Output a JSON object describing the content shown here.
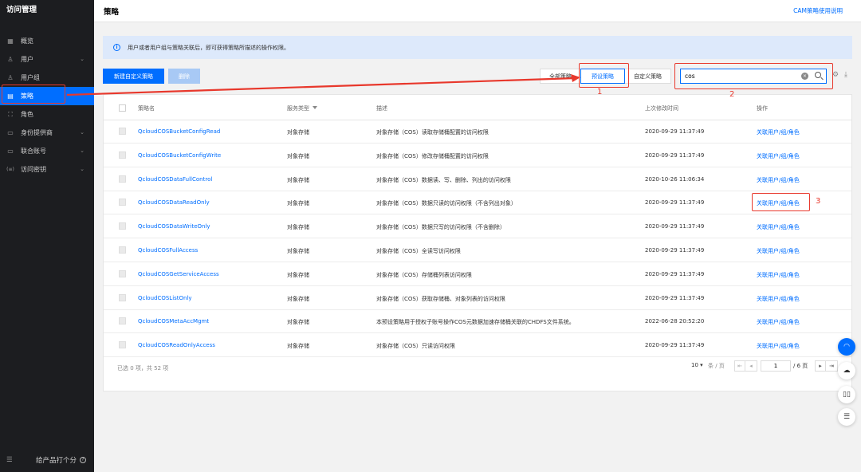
{
  "app": {
    "title": "访问管理"
  },
  "sidebar": {
    "items": [
      {
        "label": "概览",
        "icon": "grid-icon",
        "chevron": false,
        "active": false
      },
      {
        "label": "用户",
        "icon": "user-icon",
        "chevron": true,
        "active": false
      },
      {
        "label": "用户组",
        "icon": "users-icon",
        "chevron": false,
        "active": false
      },
      {
        "label": "策略",
        "icon": "policy-icon",
        "chevron": false,
        "active": true
      },
      {
        "label": "角色",
        "icon": "role-icon",
        "chevron": false,
        "active": false
      },
      {
        "label": "身份提供商",
        "icon": "idp-icon",
        "chevron": true,
        "active": false
      },
      {
        "label": "联合账号",
        "icon": "account-icon",
        "chevron": true,
        "active": false
      },
      {
        "label": "访问密钥",
        "icon": "key-icon",
        "chevron": true,
        "active": false
      }
    ],
    "feedback_label": "给产品打个分"
  },
  "header": {
    "title": "策略",
    "doc_link": "CAM策略使用说明"
  },
  "info": {
    "text": "用户或者用户组与策略关联后，即可获得策略所描述的操作权限。"
  },
  "toolbar": {
    "create_label": "新建自定义策略",
    "delete_label": "删除",
    "tabs": [
      "全部策略",
      "预设策略",
      "自定义策略"
    ],
    "active_tab": 1,
    "search_value": "cos"
  },
  "annotations": {
    "one": "1",
    "two": "2",
    "three": "3"
  },
  "table": {
    "headers": {
      "name": "策略名",
      "service": "服务类型",
      "desc": "描述",
      "time": "上次修改时间",
      "op": "操作"
    },
    "rows": [
      {
        "name": "QcloudCOSBucketConfigRead",
        "service": "对象存储",
        "desc": "对象存储（COS）读取存储桶配置的访问权限",
        "time": "2020-09-29 11:37:49",
        "op": "关联用户/组/角色"
      },
      {
        "name": "QcloudCOSBucketConfigWrite",
        "service": "对象存储",
        "desc": "对象存储（COS）修改存储桶配置的访问权限",
        "time": "2020-09-29 11:37:49",
        "op": "关联用户/组/角色"
      },
      {
        "name": "QcloudCOSDataFullControl",
        "service": "对象存储",
        "desc": "对象存储（COS）数据读、写、删除、列出的访问权限",
        "time": "2020-10-26 11:06:34",
        "op": "关联用户/组/角色"
      },
      {
        "name": "QcloudCOSDataReadOnly",
        "service": "对象存储",
        "desc": "对象存储（COS）数据只读的访问权限（不含列出对象）",
        "time": "2020-09-29 11:37:49",
        "op": "关联用户/组/角色"
      },
      {
        "name": "QcloudCOSDataWriteOnly",
        "service": "对象存储",
        "desc": "对象存储（COS）数据只写的访问权限（不含删除）",
        "time": "2020-09-29 11:37:49",
        "op": "关联用户/组/角色"
      },
      {
        "name": "QcloudCOSFullAccess",
        "service": "对象存储",
        "desc": "对象存储（COS）全读写访问权限",
        "time": "2020-09-29 11:37:49",
        "op": "关联用户/组/角色"
      },
      {
        "name": "QcloudCOSGetServiceAccess",
        "service": "对象存储",
        "desc": "对象存储（COS）存储桶列表访问权限",
        "time": "2020-09-29 11:37:49",
        "op": "关联用户/组/角色"
      },
      {
        "name": "QcloudCOSListOnly",
        "service": "对象存储",
        "desc": "对象存储（COS）获取存储桶、对象列表的访问权限",
        "time": "2020-09-29 11:37:49",
        "op": "关联用户/组/角色"
      },
      {
        "name": "QcloudCOSMetaAccMgmt",
        "service": "对象存储",
        "desc": "本预设策略用于授权子账号操作COS元数据加速存储桶关联的CHDFS文件系统。",
        "time": "2022-06-28 20:52:20",
        "op": "关联用户/组/角色"
      },
      {
        "name": "QcloudCOSReadOnlyAccess",
        "service": "对象存储",
        "desc": "对象存储（COS）只读访问权限",
        "time": "2020-09-29 11:37:49",
        "op": "关联用户/组/角色"
      }
    ],
    "footer": "已选 0 项，共 52 项"
  },
  "pagination": {
    "page_size": "10 ▾",
    "per_page_label": "条 / 页",
    "current_page": "1",
    "total_label": "/ 6 页"
  },
  "colors": {
    "accent": "#006eff",
    "annotation": "#e8382c",
    "sidebar_bg": "#1c1d20"
  }
}
